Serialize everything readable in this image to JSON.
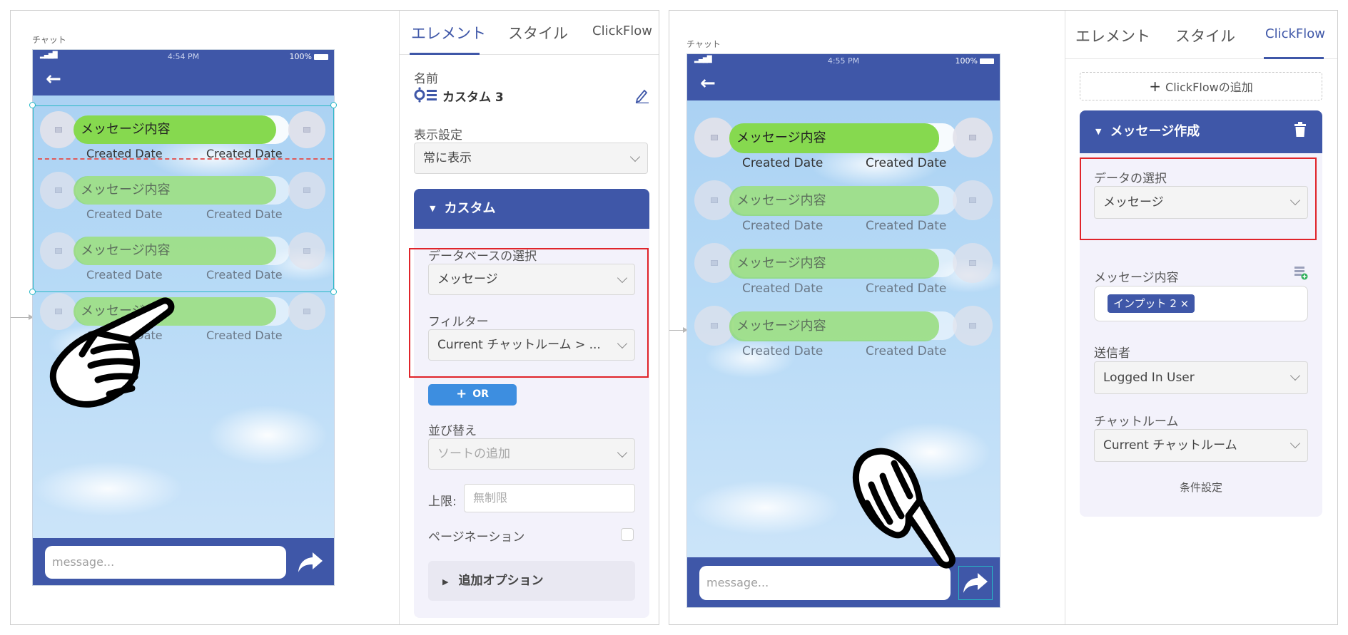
{
  "left": {
    "canvas_label": "チャット",
    "phone": {
      "time": "4:54 PM",
      "battery": "100%",
      "messages": [
        {
          "text": "メッセージ内容",
          "date_left": "Created Date",
          "date_right": "Created Date"
        },
        {
          "text": "メッセージ内容",
          "date_left": "Created Date",
          "date_right": "Created Date"
        },
        {
          "text": "メッセージ内容",
          "date_left": "Created Date",
          "date_right": "Created Date"
        },
        {
          "text": "メッセージ内容",
          "date_left": "Created Date",
          "date_right": "Created Date"
        }
      ],
      "input_placeholder": "message..."
    },
    "props": {
      "tabs": [
        "エレメント",
        "スタイル",
        "ClickFlow"
      ],
      "name_label": "名前",
      "name_value": "カスタム 3",
      "display_label": "表示設定",
      "display_value": "常に表示",
      "custom_header": "カスタム",
      "db_label": "データベースの選択",
      "db_value": "メッセージ",
      "filter_label": "フィルター",
      "filter_value": "Current チャットルーム > ...",
      "or_button": "OR",
      "sort_label": "並び替え",
      "sort_placeholder": "ソートの追加",
      "limit_label": "上限:",
      "limit_placeholder": "無制限",
      "pagination_label": "ページネーション",
      "extra_options": "追加オプション"
    }
  },
  "right": {
    "canvas_label": "チャット",
    "phone": {
      "time": "4:55 PM",
      "battery": "100%",
      "messages": [
        {
          "text": "メッセージ内容",
          "date_left": "Created Date",
          "date_right": "Created Date"
        },
        {
          "text": "メッセージ内容",
          "date_left": "Created Date",
          "date_right": "Created Date"
        },
        {
          "text": "メッセージ内容",
          "date_left": "Created Date",
          "date_right": "Created Date"
        },
        {
          "text": "メッセージ内容",
          "date_left": "Created Date",
          "date_right": "Created Date"
        }
      ],
      "input_placeholder": "message..."
    },
    "props": {
      "tabs": [
        "エレメント",
        "スタイル",
        "ClickFlow"
      ],
      "add_clickflow": "ClickFlowの追加",
      "flow_header": "メッセージ作成",
      "data_select_label": "データの選択",
      "data_select_value": "メッセージ",
      "content_label": "メッセージ内容",
      "content_tag": "インプット 2 ×",
      "sender_label": "送信者",
      "sender_value": "Logged In User",
      "room_label": "チャットルーム",
      "room_value": "Current チャットルーム",
      "condition_link": "条件設定"
    }
  },
  "colors": {
    "accent": "#3f57a8",
    "bubble": "#86d94f",
    "highlight": "#e0242a",
    "selection": "#27b8c6"
  },
  "icons": [
    "back-arrow-icon",
    "send-arrow-icon",
    "pencil-icon",
    "custom-element-icon",
    "trash-icon",
    "database-add-icon",
    "plus-icon",
    "chevron-down-icon",
    "pointing-hand-icon"
  ]
}
